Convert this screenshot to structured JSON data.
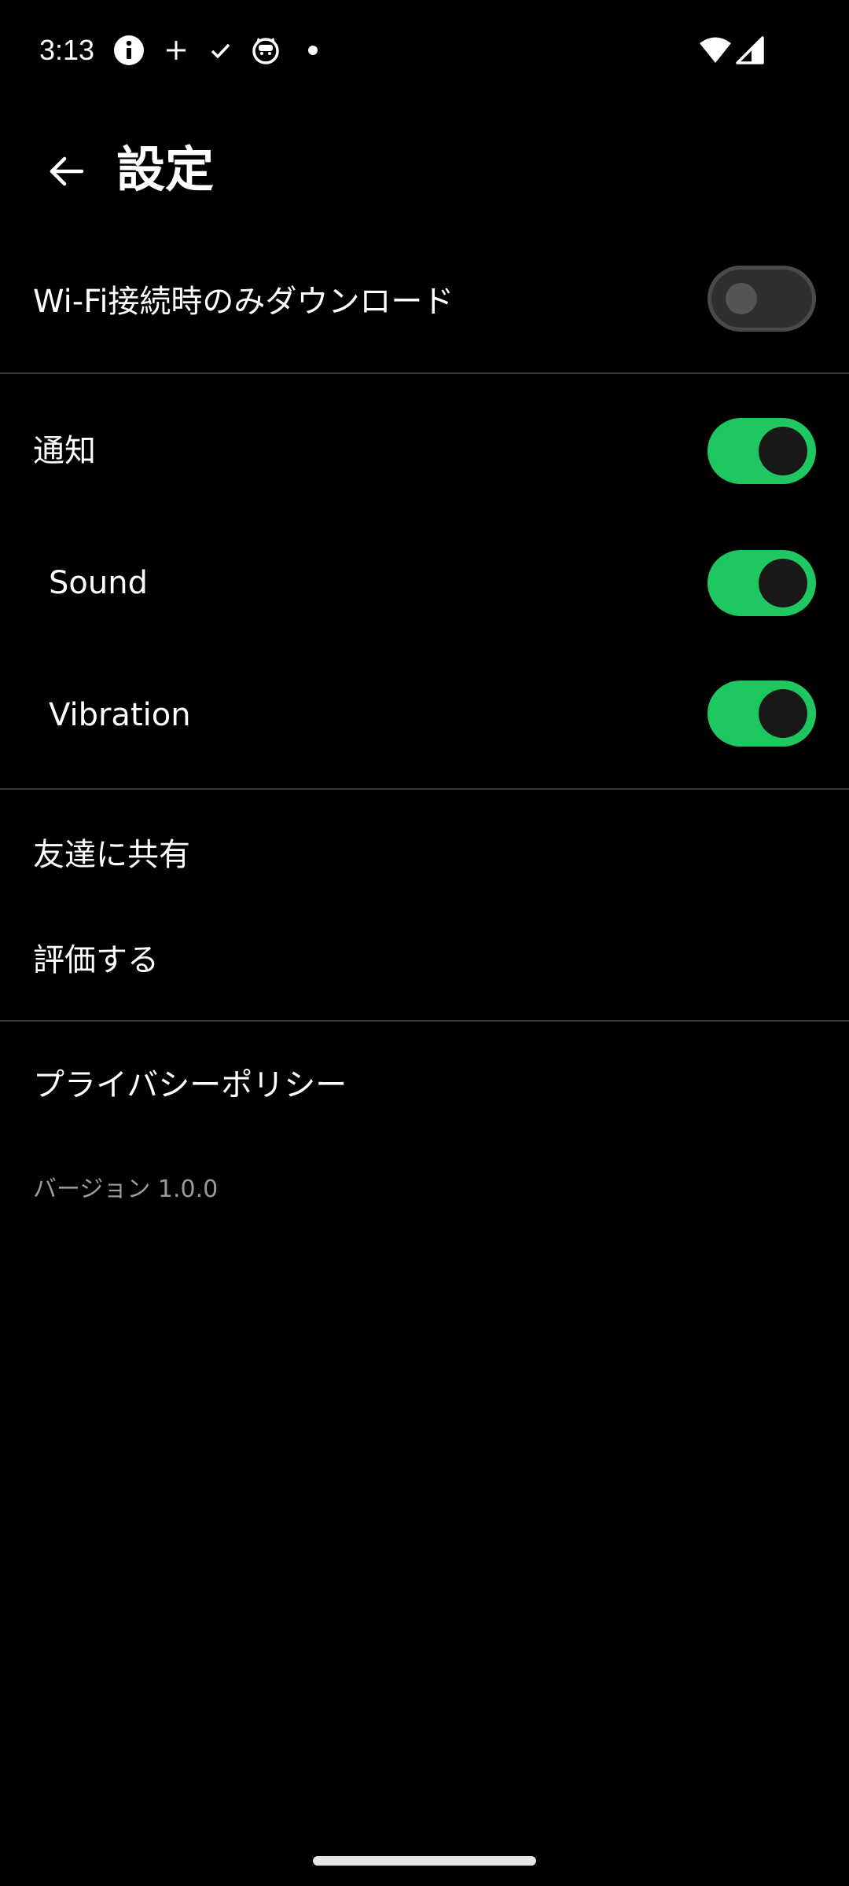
{
  "status_bar": {
    "time": "3:13",
    "icons": [
      "info-icon",
      "plus-icon",
      "check-icon",
      "cat-face-icon",
      "dot-icon",
      "wifi-icon",
      "cellular-signal-icon"
    ]
  },
  "app_bar": {
    "title": "設定",
    "back_icon": "arrow-back-icon"
  },
  "settings": {
    "wifi_only": {
      "label": "Wi-Fi接続時のみダウンロード",
      "enabled": false
    },
    "notifications": {
      "label": "通知",
      "enabled": true
    },
    "sound": {
      "label": "Sound",
      "enabled": true
    },
    "vibration": {
      "label": "Vibration",
      "enabled": true
    },
    "share": {
      "label": "友達に共有"
    },
    "rate": {
      "label": "評価する"
    },
    "privacy": {
      "label": "プライバシーポリシー"
    },
    "version": "バージョン 1.0.0"
  },
  "colors": {
    "background": "#000000",
    "accent": "#1ec760",
    "divider": "#3a3a3a",
    "secondary_text": "#9b9b9b"
  }
}
